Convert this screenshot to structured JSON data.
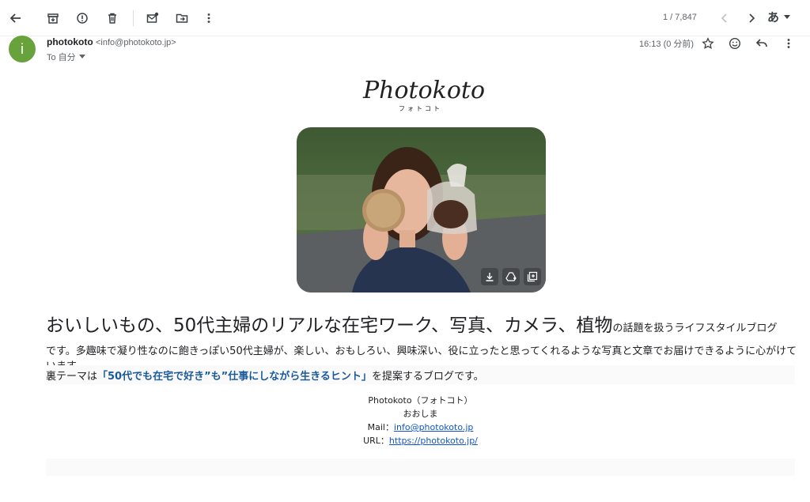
{
  "toolbar": {
    "icons": [
      "back-arrow-icon",
      "archive-icon",
      "report-spam-icon",
      "delete-icon",
      "mark-unread-icon",
      "move-to-icon",
      "more-vert-icon"
    ],
    "counter": "1 / 7,847",
    "language": "あ"
  },
  "header": {
    "avatar_letter": "i",
    "avatar_color": "#68a23c",
    "sender_name": "photokoto",
    "sender_email": "<info@photokoto.jp>",
    "to_label": "To 自分",
    "time": "16:13 (0 分前)"
  },
  "body": {
    "logo_text": "Photokoto",
    "logo_sub": "フォトコト",
    "headline_big": "おいしいもの、50代主婦のリアルな在宅ワーク、写真、カメラ、植物",
    "headline_small": "の話題を扱うライフスタイルブログ",
    "description": "です。多趣味で凝り性なのに飽きっぽい50代主婦が、楽しい、おもしろい、興味深い、役に立ったと思ってくれるような写真と文章でお届けできるように心がけています。",
    "theme_prefix": "裏テーマは",
    "theme_highlight": "「50代でも在宅で好き”も”仕事にしながら生きるヒント」",
    "theme_suffix": "を提案するブログです。"
  },
  "signature": {
    "name": "Photokoto（フォトコト）",
    "author": "おおしま",
    "mail_label": "Mail：",
    "mail": "info@photokoto.jp",
    "url_label": "URL：",
    "url": "https://photokoto.jp/"
  }
}
